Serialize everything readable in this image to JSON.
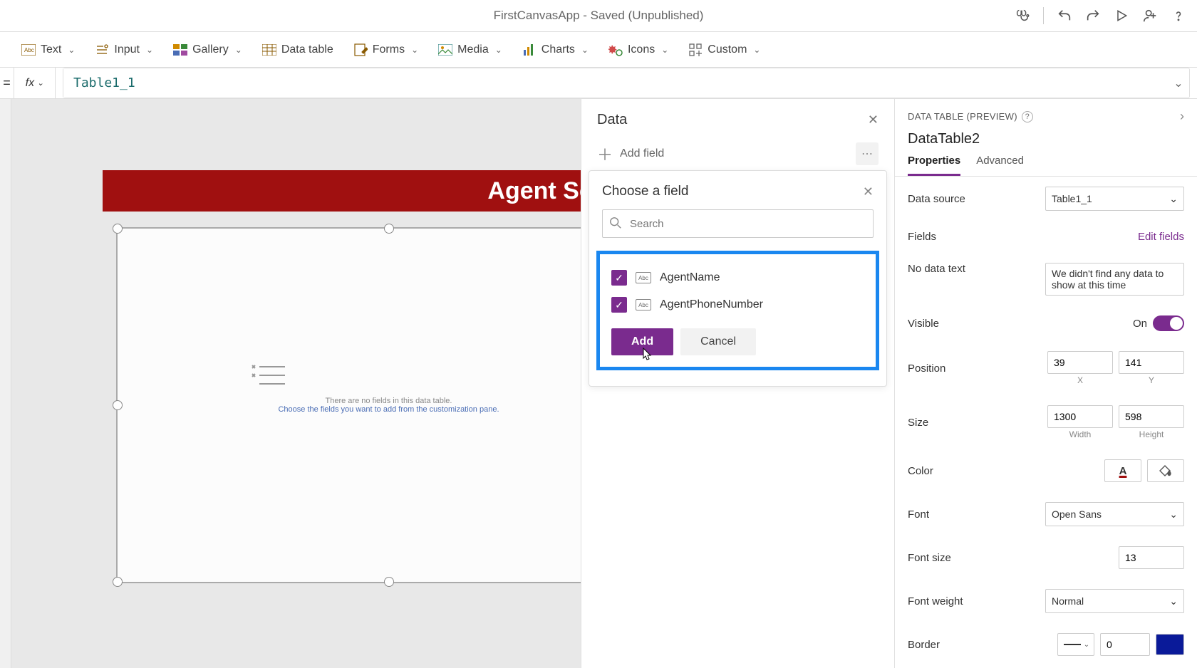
{
  "titlebar": {
    "title": "FirstCanvasApp - Saved (Unpublished)"
  },
  "ribbon": {
    "text": "Text",
    "input": "Input",
    "gallery": "Gallery",
    "datatable": "Data table",
    "forms": "Forms",
    "media": "Media",
    "charts": "Charts",
    "icons": "Icons",
    "custom": "Custom"
  },
  "formula": {
    "value": "Table1_1"
  },
  "canvas": {
    "screenTitle": "Agent Screen",
    "emptyLine1": "There are no fields in this data table.",
    "emptyLine2": "Choose the fields you want to add from the customization pane."
  },
  "dataPane": {
    "title": "Data",
    "addField": "Add field",
    "popover": {
      "title": "Choose a field",
      "searchPlaceholder": "Search",
      "fields": {
        "f1": "AgentName",
        "f2": "AgentPhoneNumber"
      },
      "add": "Add",
      "cancel": "Cancel"
    }
  },
  "propPane": {
    "sectionTitle": "DATA TABLE (PREVIEW)",
    "name": "DataTable2",
    "tabs": {
      "properties": "Properties",
      "advanced": "Advanced"
    },
    "dataSource": {
      "label": "Data source",
      "value": "Table1_1"
    },
    "fields": {
      "label": "Fields",
      "link": "Edit fields"
    },
    "noDataText": {
      "label": "No data text",
      "value": "We didn't find any data to show at this time"
    },
    "visible": {
      "label": "Visible",
      "on": "On"
    },
    "position": {
      "label": "Position",
      "x": "39",
      "y": "141",
      "xLabel": "X",
      "yLabel": "Y"
    },
    "size": {
      "label": "Size",
      "w": "1300",
      "h": "598",
      "wLabel": "Width",
      "hLabel": "Height"
    },
    "color": {
      "label": "Color"
    },
    "font": {
      "label": "Font",
      "value": "Open Sans"
    },
    "fontSize": {
      "label": "Font size",
      "value": "13"
    },
    "fontWeight": {
      "label": "Font weight",
      "value": "Normal"
    },
    "border": {
      "label": "Border",
      "width": "0"
    }
  }
}
